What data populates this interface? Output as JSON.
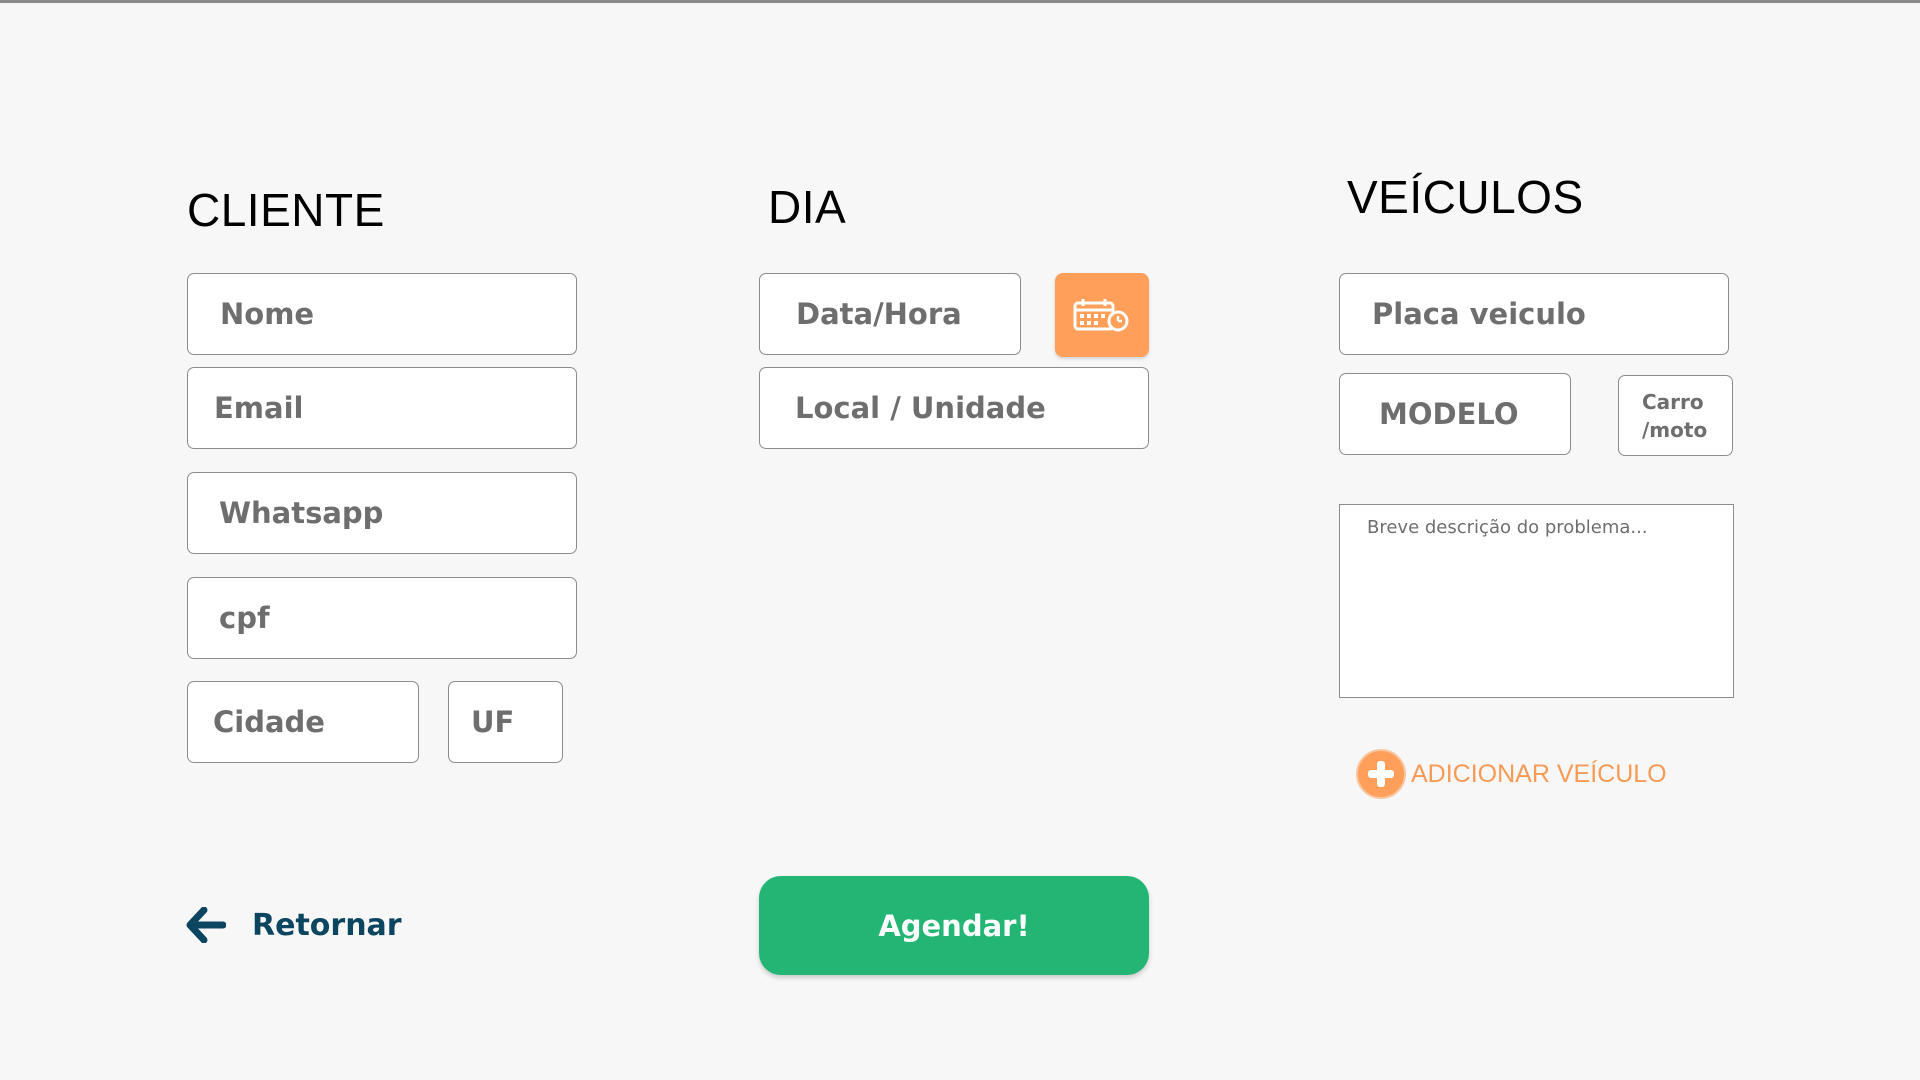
{
  "cliente": {
    "title": "CLIENTE",
    "fields": {
      "nome": "Nome",
      "email": "Email",
      "whatsapp": "Whatsapp",
      "cpf": "cpf",
      "cidade": "Cidade",
      "uf": "UF"
    }
  },
  "dia": {
    "title": "DIA",
    "fields": {
      "data_hora": "Data/Hora",
      "local": "Local / Unidade"
    },
    "calendar_icon": "calendar-clock-icon"
  },
  "veiculos": {
    "title": "VEÍCULOS",
    "fields": {
      "placa": "Placa veiculo",
      "modelo": "MODELO",
      "tipo_line1": "Carro",
      "tipo_line2": "/moto"
    },
    "descricao_placeholder": "Breve descrição do problema...",
    "add_label": "ADICIONAR VEÍCULO",
    "add_icon": "plus-circle-icon"
  },
  "actions": {
    "return_label": "Retornar",
    "return_icon": "arrow-left-icon",
    "submit_label": "Agendar!"
  },
  "colors": {
    "accent_orange": "#ff9f5a",
    "submit_green": "#22b573",
    "link_blue": "#0c4560"
  }
}
